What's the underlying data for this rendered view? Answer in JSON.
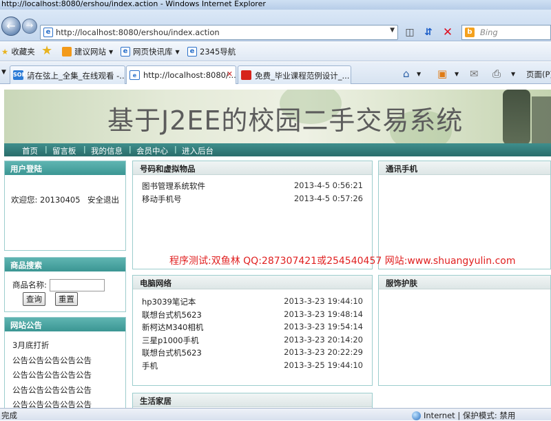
{
  "browser": {
    "window_title": "http://localhost:8080/ershou/index.action - Windows Internet Explorer",
    "address": "http://localhost:8080/ershou/index.action",
    "search_placeholder": "Bing",
    "favorites": {
      "label": "收藏夹",
      "items": [
        "建议网站",
        "网页快讯库",
        "2345导航"
      ]
    },
    "tabs": [
      {
        "label": "箭在弦上_全集_在线观看 -...",
        "icon": "SOKU"
      },
      {
        "label": "http://localhost:8080/...",
        "icon": "e"
      },
      {
        "label": "免费_毕业课程范例设计_...",
        "icon": ""
      }
    ],
    "page_menu_label": "页面(P)",
    "status_left": "完成",
    "status_zone": "Internet | 保护模式: 禁用"
  },
  "site": {
    "title": "基于J2EE的校园二手交易系统",
    "nav": [
      "首页",
      "留言板",
      "我的信息",
      "会员中心",
      "进入后台"
    ]
  },
  "login_panel": {
    "title": "用户登陆",
    "welcome_label": "欢迎您:",
    "username": "20130405",
    "logout": "安全退出"
  },
  "search_panel": {
    "title": "商品搜索",
    "field_label": "商品名称:",
    "query_button": "查询",
    "reset_button": "重置"
  },
  "notice_panel": {
    "title": "网站公告",
    "items": [
      "3月底打折",
      "公告公告公告公告公告",
      "公告公告公告公告公告",
      "公告公告公告公告公告",
      "公告公告公告公告公告"
    ]
  },
  "categories": [
    {
      "title": "号码和虚拟物品",
      "items": [
        {
          "name": "图书管理系统软件",
          "date": "2013-4-5 0:56:21"
        },
        {
          "name": "移动手机号",
          "date": "2013-4-5 0:57:26"
        }
      ]
    },
    {
      "title": "通讯手机",
      "items": []
    },
    {
      "title": "电脑网络",
      "items": [
        {
          "name": "hp3039笔记本",
          "date": "2013-3-23 19:44:10"
        },
        {
          "name": "联想台式机5623",
          "date": "2013-3-23 19:48:14"
        },
        {
          "name": "新柯达M340相机",
          "date": "2013-3-23 19:54:14"
        },
        {
          "name": "三星p1000手机",
          "date": "2013-3-23 20:14:20"
        },
        {
          "name": "联想台式机5623",
          "date": "2013-3-23 20:22:29"
        },
        {
          "name": "手机",
          "date": "2013-3-25 19:44:10"
        }
      ]
    },
    {
      "title": "服饰护肤",
      "items": []
    },
    {
      "title": "生活家居",
      "items": []
    }
  ],
  "watermark": "程序测试:双鱼林 QQ:287307421或254540457 网站:www.shuangyulin.com"
}
